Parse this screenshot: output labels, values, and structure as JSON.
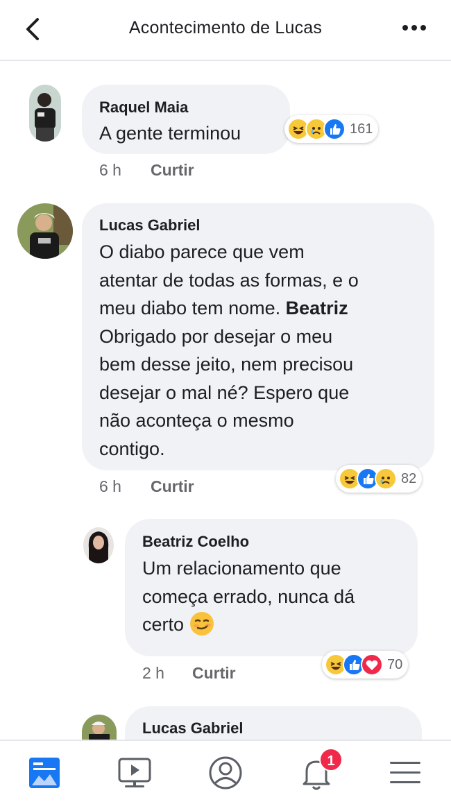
{
  "header": {
    "title": "Acontecimento de Lucas",
    "back_icon": "chevron-left-icon",
    "more_icon": "more-dots-icon"
  },
  "comments": [
    {
      "author": "Raquel Maia",
      "text": "A gente terminou",
      "time": "6 h",
      "like_label": "Curtir",
      "reactions": [
        "haha",
        "sad",
        "like"
      ],
      "reaction_count": "161"
    },
    {
      "author": "Lucas Gabriel",
      "text_lines": [
        "O diabo parece que vem",
        "atentar de todas as formas, e o",
        "meu diabo tem nome. ",
        "Beatriz",
        "Obrigado por desejar o meu",
        "bem desse jeito, nem precisou",
        "desejar o mal né? Espero que",
        "não aconteça o mesmo",
        "contigo."
      ],
      "time": "6 h",
      "like_label": "Curtir",
      "reactions": [
        "haha",
        "like",
        "sad"
      ],
      "reaction_count": "82"
    },
    {
      "author": "Beatriz Coelho",
      "text_lines": [
        "Um relacionamento que",
        "começa errado, nunca dá",
        "certo "
      ],
      "emoji": "smirk-emoji",
      "time": "2 h",
      "like_label": "Curtir",
      "reactions": [
        "haha",
        "like",
        "love"
      ],
      "reaction_count": "70"
    },
    {
      "author": "Lucas Gabriel"
    }
  ],
  "bottom_nav": {
    "items": [
      "news-feed-icon",
      "watch-icon",
      "profile-icon",
      "notifications-icon",
      "menu-icon"
    ],
    "notification_badge": "1",
    "accent": "#1877f2"
  }
}
